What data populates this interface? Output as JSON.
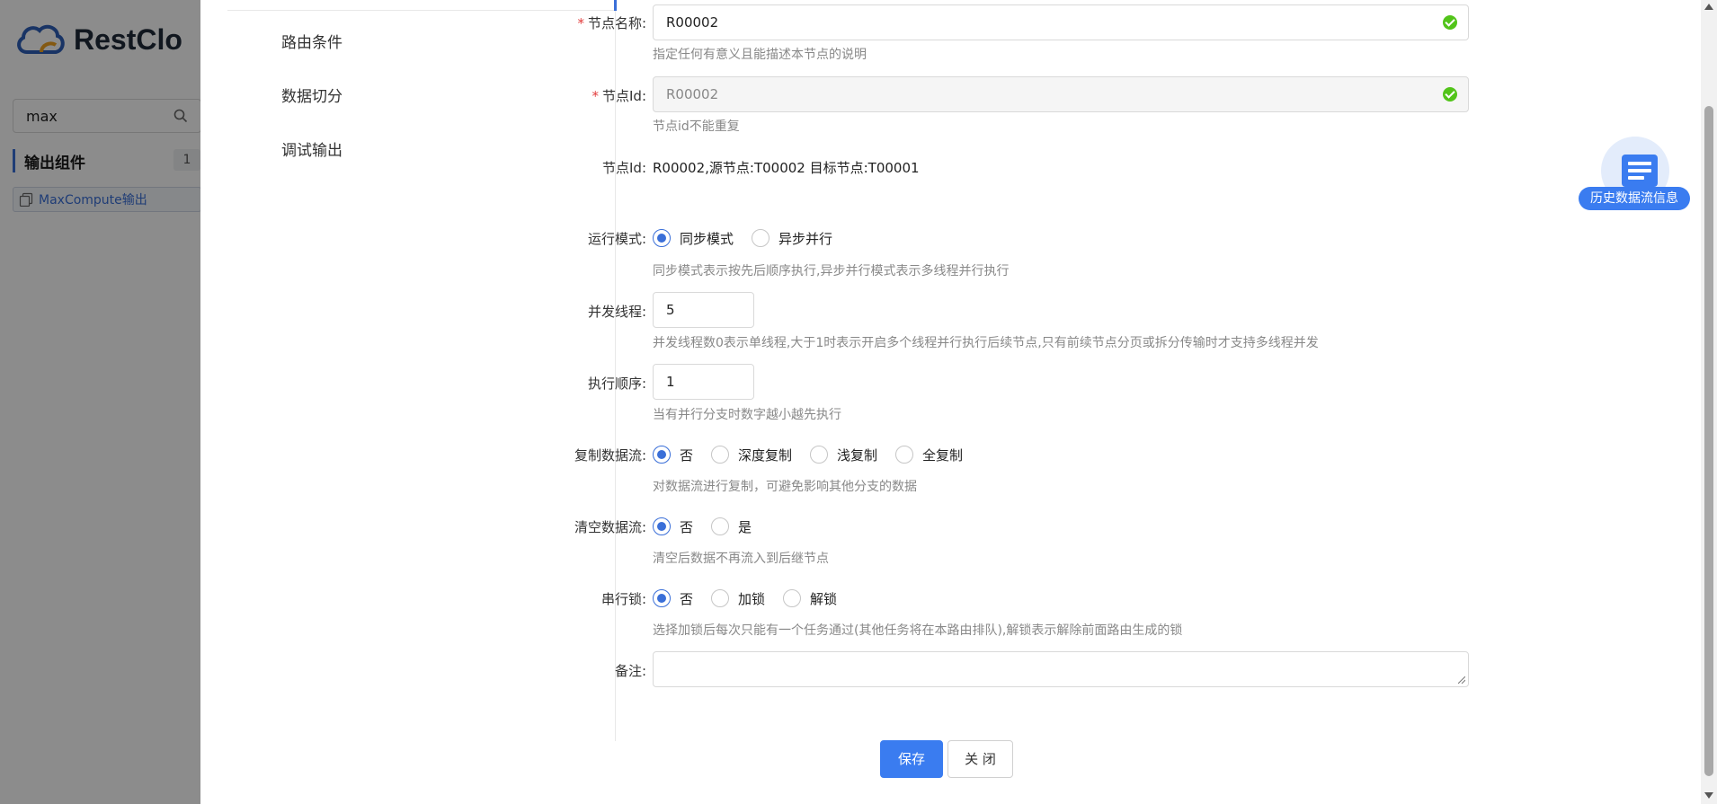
{
  "background": {
    "brand": "RestClo",
    "search_value": "max",
    "group_label": "输出组件",
    "group_count": "1",
    "item_label": "MaxCompute输出"
  },
  "tabs": [
    {
      "label": "路由条件"
    },
    {
      "label": "数据切分"
    },
    {
      "label": "调试输出"
    }
  ],
  "form": {
    "node_name": {
      "label": "节点名称:",
      "value": "R00002",
      "hint": "指定任何有意义且能描述本节点的说明"
    },
    "node_id": {
      "label": "节点Id:",
      "value": "R00002",
      "hint": "节点id不能重复"
    },
    "node_info": {
      "label": "节点Id:",
      "value": "R00002,源节点:T00002 目标节点:T00001"
    },
    "run_mode": {
      "label": "运行模式:",
      "options": [
        "同步模式",
        "异步并行"
      ],
      "selected": "同步模式",
      "hint": "同步模式表示按先后顺序执行,异步并行模式表示多线程并行执行"
    },
    "threads": {
      "label": "并发线程:",
      "value": "5",
      "hint": "并发线程数0表示单线程,大于1时表示开启多个线程并行执行后续节点,只有前续节点分页或拆分传输时才支持多线程并发"
    },
    "order": {
      "label": "执行顺序:",
      "value": "1",
      "hint": "当有并行分支时数字越小越先执行"
    },
    "copy_flow": {
      "label": "复制数据流:",
      "options": [
        "否",
        "深度复制",
        "浅复制",
        "全复制"
      ],
      "selected": "否",
      "hint": "对数据流进行复制，可避免影响其他分支的数据"
    },
    "clear_flow": {
      "label": "清空数据流:",
      "options": [
        "否",
        "是"
      ],
      "selected": "否",
      "hint": "清空后数据不再流入到后继节点"
    },
    "serial_lock": {
      "label": "串行锁:",
      "options": [
        "否",
        "加锁",
        "解锁"
      ],
      "selected": "否",
      "hint": "选择加锁后每次只能有一个任务通过(其他任务将在本路由排队),解锁表示解除前面路由生成的锁"
    },
    "remark": {
      "label": "备注:",
      "value": ""
    }
  },
  "buttons": {
    "save": "保存",
    "close": "关 闭"
  },
  "history": {
    "label": "历史数据流信息"
  },
  "colors": {
    "primary": "#3a7cf0",
    "success": "#52c41a",
    "required": "#e23c3c"
  }
}
